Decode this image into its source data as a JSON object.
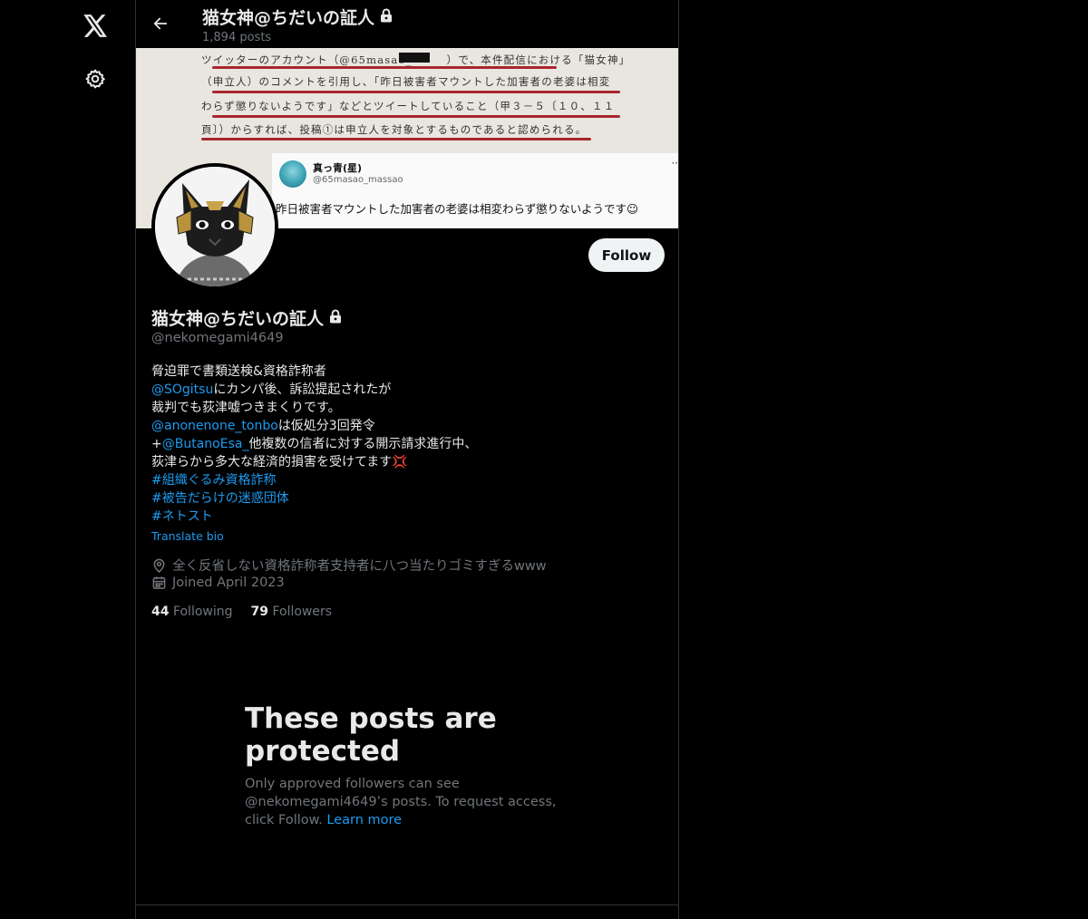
{
  "nav": {
    "logo_icon": "x-logo-icon",
    "settings_icon": "gear-icon"
  },
  "header": {
    "title": "猫女神@ちだいの証人",
    "post_count": "1,894 posts"
  },
  "banner": {
    "doc_lines": [
      "ツイッターのアカウント（@65masao_　　　）で、本件配信における「猫女神」",
      "（申立人）のコメントを引用し、「昨日被害者マウントした加害者の老婆は相変",
      "わらず懲りないようです」などとツイートしていること（甲３－５〔１０、１１",
      "頁〕）からすれば、投稿①は申立人を対象とするものであると認められる。"
    ],
    "tweet": {
      "name": "真っ青(星)",
      "handle": "@65masao_massao",
      "text": "昨日被害者マウントした加害者の老婆は相変わらず懲りないようです☺",
      "more": "··"
    }
  },
  "profile": {
    "display_name": "猫女神@ちだいの証人",
    "handle": "@nekomegami4649",
    "follow_label": "Follow",
    "bio": {
      "l1": "脅迫罪で書類送検&資格詐称者",
      "l2_link": "@SOgitsu",
      "l2_text": "にカンパ後、訴訟提起されたが",
      "l3": "裁判でも荻津嘘つきまくりです。",
      "l4_link": "@anonenone_tonbo",
      "l4_text": "は仮処分3回発令",
      "l5_prefix": "+",
      "l5_link": "@ButanoEsa_",
      "l5_text": "他複数の信者に対する開示請求進行中、",
      "l6": "荻津らから多大な経済的損害を受けてます💢",
      "tag1": "#組織ぐるみ資格詐称",
      "tag2": "#被告だらけの迷惑団体",
      "tag3": "#ネトスト"
    },
    "translate_label": "Translate bio",
    "location": "全く反省しない資格詐称者支持者に八つ当たりゴミすぎるwww",
    "joined": "Joined April 2023",
    "following_count": "44",
    "following_label": "Following",
    "followers_count": "79",
    "followers_label": "Followers"
  },
  "protected": {
    "title": "These posts are protected",
    "desc": "Only approved followers can see @nekomegami4649’s posts. To request access, click Follow.",
    "learn_more": "Learn more"
  },
  "colors": {
    "accent": "#1d9bf0",
    "muted": "#71767b",
    "text": "#e7e9ea",
    "border": "#2f3336",
    "underline": "#a8262e"
  }
}
